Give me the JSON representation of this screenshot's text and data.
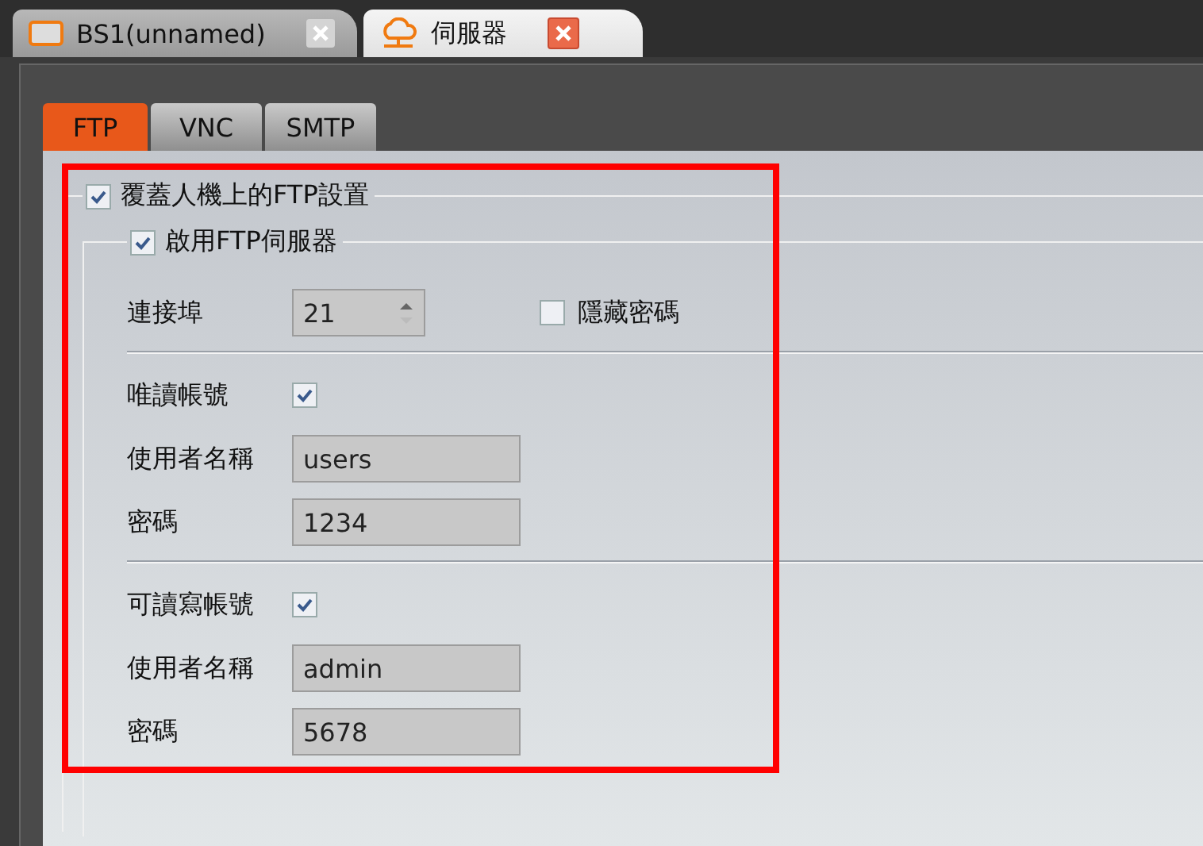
{
  "tabs": [
    {
      "label": "BS1(unnamed)",
      "selected": false,
      "kind": "window"
    },
    {
      "label": "伺服器",
      "selected": true,
      "kind": "server"
    }
  ],
  "sub_tabs": [
    {
      "label": "FTP",
      "selected": true
    },
    {
      "label": "VNC",
      "selected": false
    },
    {
      "label": "SMTP",
      "selected": false
    }
  ],
  "ftp": {
    "override": {
      "label": "覆蓋人機上的FTP設置",
      "checked": true
    },
    "server": {
      "label": "啟用FTP伺服器",
      "checked": true
    },
    "port": {
      "label": "連接埠",
      "value": "21"
    },
    "hide_password": {
      "label": "隱藏密碼",
      "checked": false
    },
    "accounts": [
      {
        "label": "唯讀帳號",
        "enabled": true,
        "username_label": "使用者名稱",
        "username": "users",
        "password_label": "密碼",
        "password": "1234"
      },
      {
        "label": "可讀寫帳號",
        "enabled": true,
        "username_label": "使用者名稱",
        "username": "admin",
        "password_label": "密碼",
        "password": "5678"
      }
    ]
  }
}
